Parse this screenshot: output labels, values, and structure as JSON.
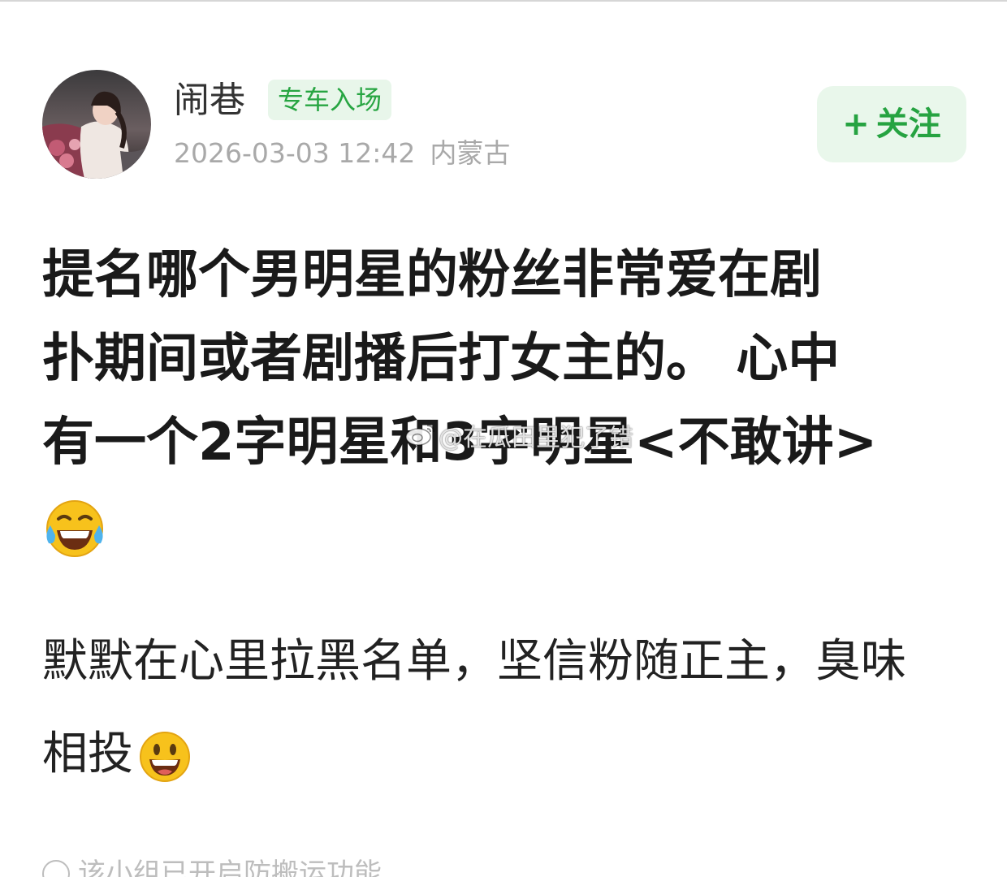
{
  "author": {
    "name": "闹巷",
    "badge": "专车入场",
    "avatar_icon": "avatar-photo"
  },
  "meta": {
    "timestamp": "2026-03-03 12:42",
    "location": "内蒙古"
  },
  "follow": {
    "plus": "+",
    "label": "关注",
    "color": "#26a341"
  },
  "title": {
    "line1": "提名哪个男明星的粉丝非常爱在剧",
    "line2": "扑期间或者剧播后打女主的。 心中",
    "line3": "有一个2字明星和3字明星<不敢讲>",
    "line4_emoji": "tears-of-joy-emoji"
  },
  "body": {
    "line1": "默默在心里拉黑名单，坚信粉随正主，臭味",
    "line2": "相投",
    "line2_emoji": "smiley-emoji"
  },
  "watermark": {
    "text": "@在瓜田里犯了错",
    "icon": "weibo-logo-icon"
  },
  "footer": {
    "notice": "该小组已开启防搬运功能",
    "icon": "info-icon"
  },
  "colors": {
    "accent_green": "#26a341",
    "badge_bg": "#e8f6ea",
    "meta_gray": "#a9a9a9"
  }
}
